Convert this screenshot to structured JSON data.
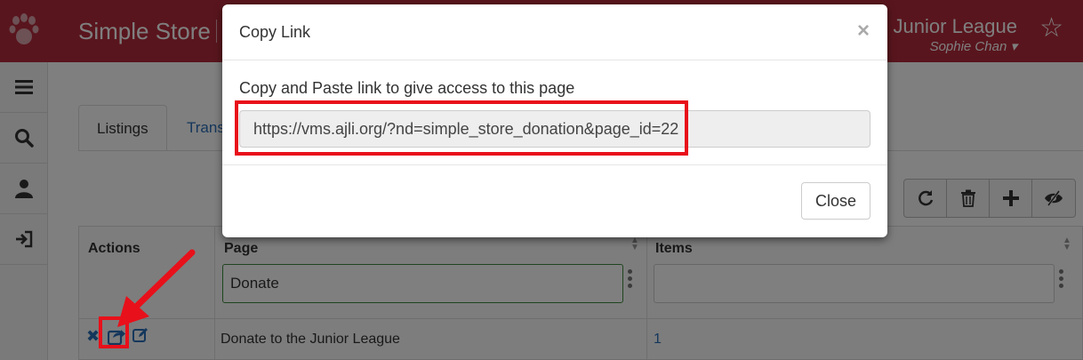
{
  "header": {
    "app_title": "Simple Store",
    "org_name": "gue Junior League",
    "user_name": "Sophie Chan"
  },
  "tabs": [
    {
      "label": "Listings"
    },
    {
      "label": "Trans"
    }
  ],
  "grid": {
    "columns": [
      "Actions",
      "Page",
      "Items"
    ],
    "filters": {
      "page": "Donate",
      "items": ""
    },
    "rows": [
      {
        "page": "Donate to the Junior League",
        "items": "1"
      }
    ]
  },
  "toolbar": {
    "icons": [
      "refresh-icon",
      "trash-icon",
      "plus-icon",
      "eye-slash-icon"
    ]
  },
  "modal": {
    "title": "Copy Link",
    "close_x": "×",
    "instruction": "Copy and Paste link to give access to this page",
    "link": "https://vms.ajli.org/?nd=simple_store_donation&page_id=22",
    "close_label": "Close"
  },
  "colors": {
    "header_bg": "#b22a3a",
    "annotation_red": "#e8101a",
    "link_blue": "#2a6fb8"
  }
}
